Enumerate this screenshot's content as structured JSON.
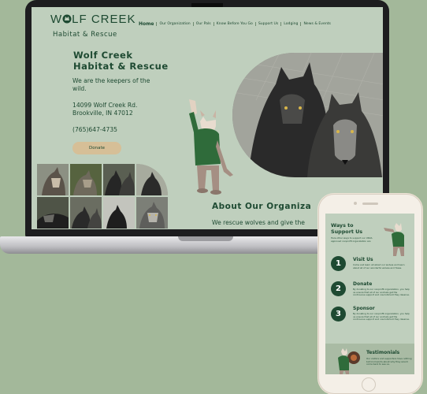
{
  "site": {
    "logo": {
      "part1": "W",
      "part2": "LF CREEK"
    },
    "logo_sub": "Habitat & Rescue",
    "nav": [
      "Home",
      "Our Organization",
      "Our Pals",
      "Know Before You Go",
      "Support Us",
      "Lodging",
      "News & Events"
    ]
  },
  "hero": {
    "title_line1": "Wolf Creek",
    "title_line2": "Habitat & Rescue",
    "tagline_line1": "We are the keepers of the",
    "tagline_line2": "wild.",
    "address_line1": "14099 Wolf Creek Rd.",
    "address_line2": "Brookville, IN 47012",
    "phone": "(765)647-4735",
    "donate_label": "Donate"
  },
  "about": {
    "title": "About Our Organiza",
    "text": "We rescue wolves and give the"
  },
  "mobile": {
    "title_line1": "Ways to",
    "title_line2": "Support Us",
    "subtitle": "Here other ways to support our USDA approved nonprofit organization are",
    "steps": [
      {
        "num": "1",
        "title": "Visit Us",
        "text": "Come and learn all about our wolves and learn about all of our wonderful wolves and foxes."
      },
      {
        "num": "2",
        "title": "Donate",
        "text": "By donating to our nonprofit organization, you help us ensure that all of our animals get the continuous support and nourishment they deserve."
      },
      {
        "num": "3",
        "title": "Sponsor",
        "text": "By donating to our nonprofit organization, you help us ensure that all of our animals get the continuous support and nourishment they deserve."
      }
    ],
    "testimonials_title": "Testimonials",
    "testimonials_text": "Our visitors and supporters have nothing but kind words about why they would come back to see us."
  },
  "colors": {
    "background": "#a3b89a",
    "site_bg": "#bfcfbd",
    "brand_green": "#1e4a32",
    "donate_button": "#d6bf97"
  }
}
